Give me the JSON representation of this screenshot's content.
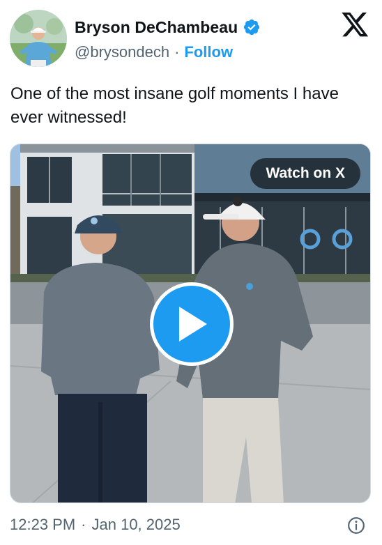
{
  "author": {
    "display_name": "Bryson DeChambeau",
    "handle": "@brysondech",
    "separator": "·",
    "follow_label": "Follow",
    "verified_icon": "verified-badge-icon",
    "avatar_icon": "avatar"
  },
  "brand": {
    "logo_icon": "x-logo-icon"
  },
  "tweet": {
    "text": "One of the most insane golf moments I have ever witnessed!"
  },
  "media": {
    "watch_label": "Watch on X",
    "play_icon": "play-icon"
  },
  "footer": {
    "time": "12:23 PM",
    "separator": "·",
    "date": "Jan 10, 2025",
    "info_icon": "info-icon"
  },
  "colors": {
    "accent": "#1d9bf0",
    "text_primary": "#0f1419",
    "text_secondary": "#536471",
    "border": "#cfd9de"
  }
}
